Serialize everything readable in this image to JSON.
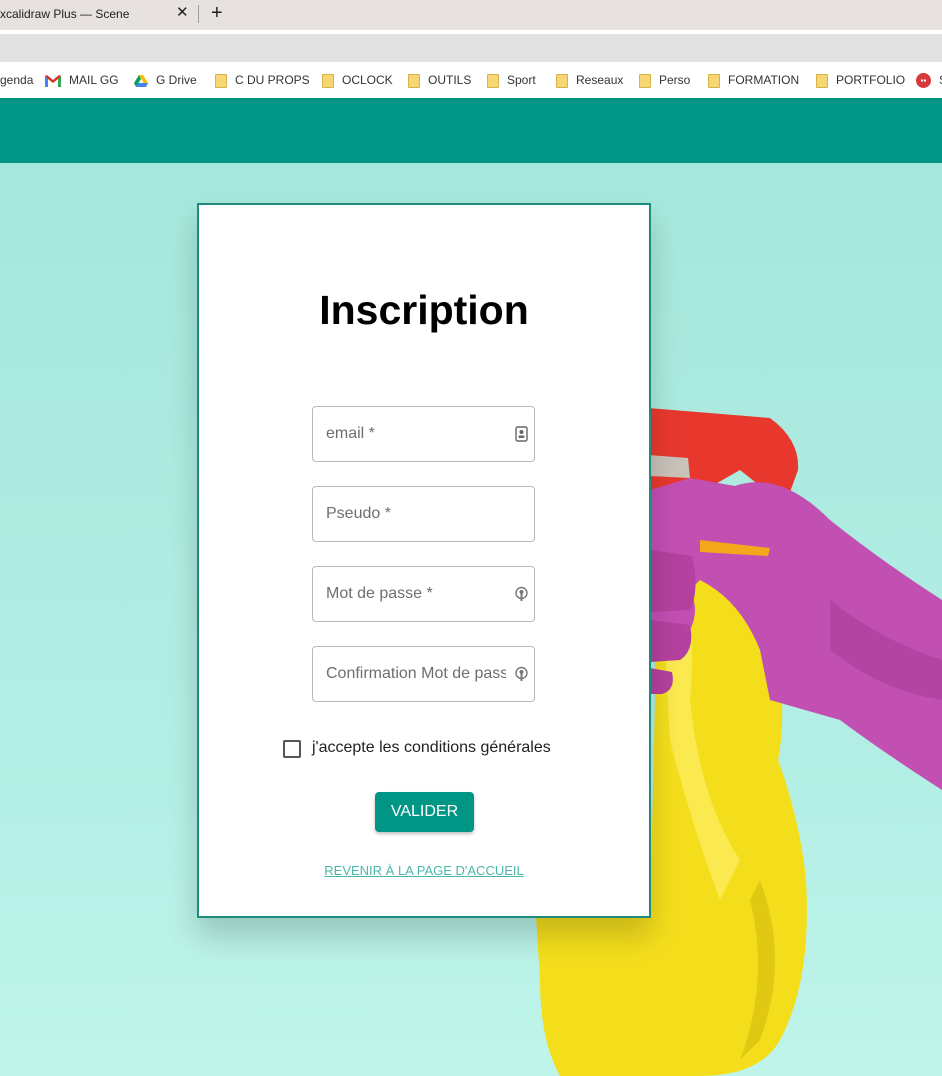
{
  "browser": {
    "tab_title": "xcalidraw Plus — Scene",
    "tab_close": "✕",
    "new_tab": "+",
    "bookmarks": [
      {
        "label": "genda",
        "icon": "none"
      },
      {
        "label": "MAIL GG",
        "icon": "gmail-icon"
      },
      {
        "label": "G Drive",
        "icon": "google-drive-icon"
      },
      {
        "label": "C DU PROPS",
        "icon": "folder-icon"
      },
      {
        "label": "OCLOCK",
        "icon": "folder-icon"
      },
      {
        "label": "OUTILS",
        "icon": "folder-icon"
      },
      {
        "label": "Sport",
        "icon": "folder-icon"
      },
      {
        "label": "Reseaux",
        "icon": "folder-icon"
      },
      {
        "label": "Perso",
        "icon": "folder-icon"
      },
      {
        "label": "FORMATION",
        "icon": "folder-icon"
      },
      {
        "label": "PORTFOLIO",
        "icon": "folder-icon"
      },
      {
        "label": "S",
        "icon": "red-circle-icon"
      }
    ]
  },
  "form": {
    "title": "Inscription",
    "email_placeholder": "email *",
    "pseudo_placeholder": "Pseudo *",
    "password_placeholder": "Mot de passe *",
    "confirm_placeholder": "Confirmation Mot de pass...",
    "terms_label": "j'accepte les conditions générales",
    "submit_label": "VALIDER",
    "home_link": "REVENIR À LA PAGE D'ACCUEIL"
  },
  "colors": {
    "header": "#009584",
    "background": "#a6e7db",
    "card_border": "#1f8b7c",
    "link": "#4ab7a8"
  }
}
